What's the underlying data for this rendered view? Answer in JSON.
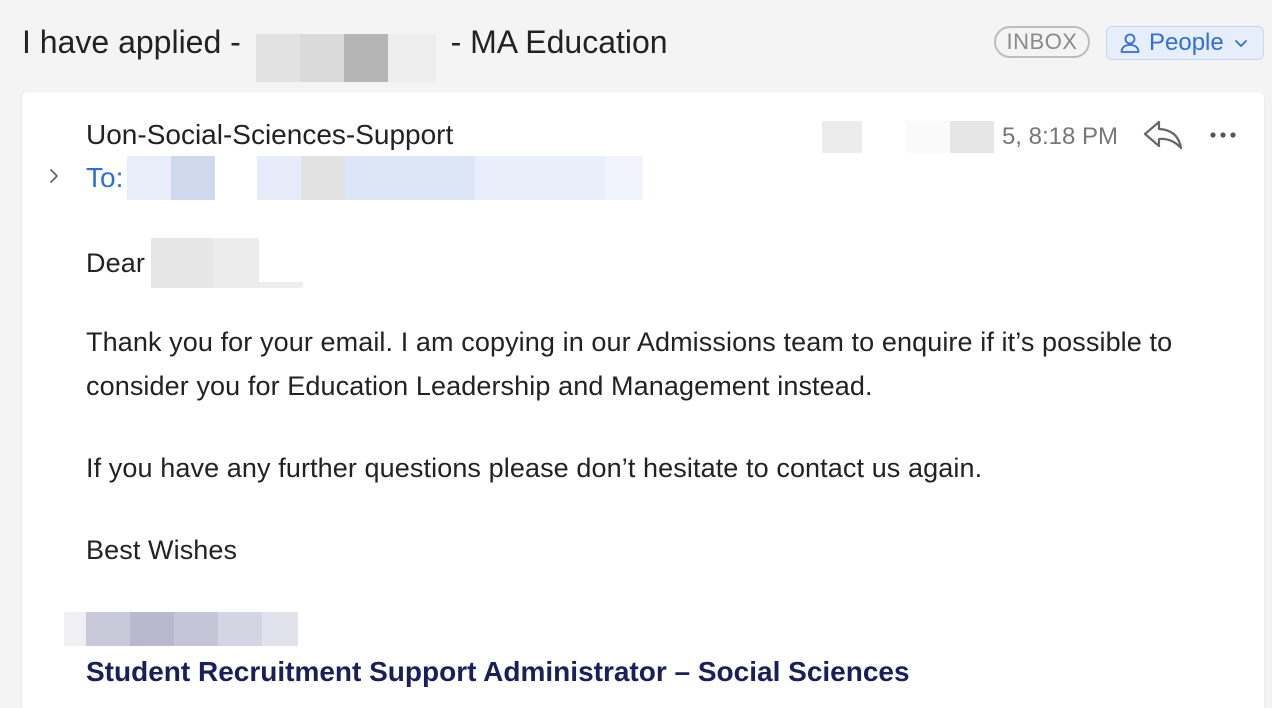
{
  "header": {
    "subject_prefix": "I have applied -",
    "subject_suffix": "- MA Education",
    "mailbox_badge": "INBOX",
    "people_button_label": "People"
  },
  "message": {
    "sender": "Uon-Social-Sciences-Support",
    "date_visible": "5, 8:18 PM",
    "to_label": "To:",
    "greeting": "Dear",
    "paragraph_1": "Thank you for your email.  I am copying in our Admissions team to enquire if it’s possible to consider you for Education Leadership and Management instead.",
    "paragraph_2": "If you have any further questions please don’t hesitate to contact us again.",
    "closing": "Best Wishes",
    "signature_title": "Student Recruitment Support Administrator – Social Sciences"
  },
  "icons": {
    "reply": "reply-icon",
    "more": "more-options-icon",
    "expand": "chevron-right-icon",
    "people": "person-icon",
    "dropdown": "chevron-down-icon"
  },
  "colors": {
    "accent_blue": "#2f6fd8",
    "signature_navy": "#1a1f5c",
    "badge_gray": "#8a8a8a"
  }
}
